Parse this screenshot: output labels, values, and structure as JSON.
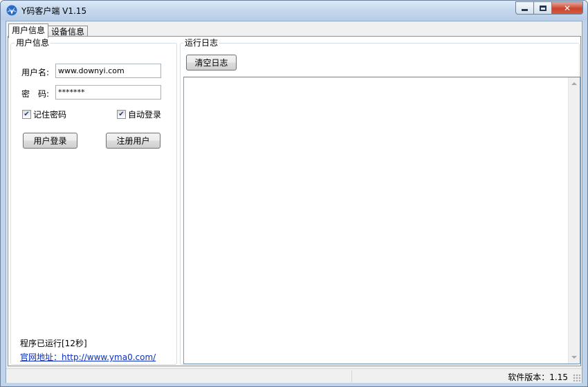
{
  "window": {
    "title": "Y码客户端 V1.15",
    "icon": "app-logo-icon",
    "close_glyph": "✕"
  },
  "tabs": [
    {
      "label": "用户信息",
      "active": true
    },
    {
      "label": "设备信息",
      "active": false
    }
  ],
  "user_group": {
    "title": "用户信息",
    "username_label": "用户名:",
    "username_value": "www.downyi.com",
    "password_label": "密　码:",
    "password_value": "*******",
    "remember_password": {
      "label": "记住密码",
      "checked": true
    },
    "auto_login": {
      "label": "自动登录",
      "checked": true
    },
    "login_button": "用户登录",
    "register_button": "注册用户",
    "running_status": "程序已运行[12秒]",
    "website": "官网地址：http://www.yma0.com/"
  },
  "log_group": {
    "title": "运行日志",
    "clear_button": "清空日志"
  },
  "statusbar": {
    "version_text": "软件版本：1.15"
  },
  "colors": {
    "title_bar": "#c6d9ef",
    "link": "#0c2fbf",
    "close_button": "#c9452d"
  }
}
